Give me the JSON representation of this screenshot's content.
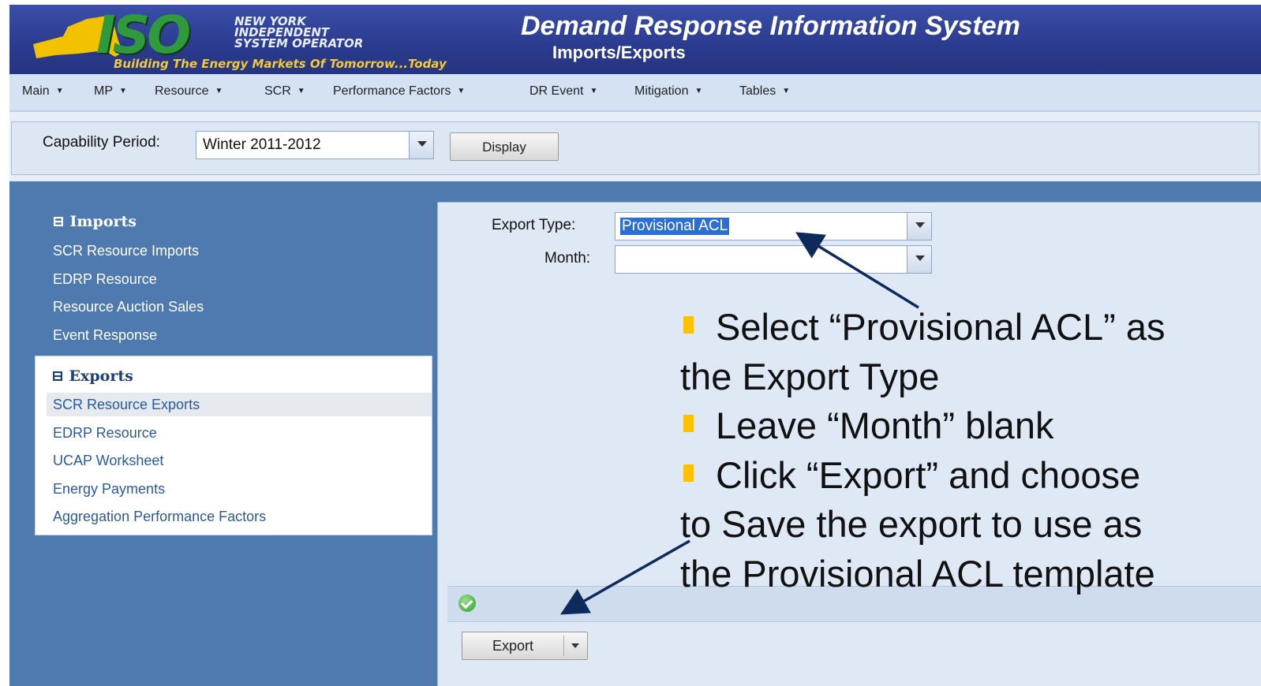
{
  "header": {
    "logo_lines": [
      "NEW YORK",
      "INDEPENDENT",
      "SYSTEM OPERATOR"
    ],
    "logo_mark": "ISO",
    "tagline": "Building The Energy Markets Of Tomorrow...Today",
    "app_title": "Demand Response Information System",
    "page_subtitle": "Imports/Exports"
  },
  "menu": [
    {
      "label": "Main"
    },
    {
      "label": "MP"
    },
    {
      "label": "Resource"
    },
    {
      "label": "SCR"
    },
    {
      "label": "Performance Factors"
    },
    {
      "label": "DR Event"
    },
    {
      "label": "Mitigation"
    },
    {
      "label": "Tables"
    }
  ],
  "toolbar": {
    "capability_label": "Capability Period:",
    "capability_value": "Winter 2011-2012",
    "display_label": "Display"
  },
  "sidebar": {
    "imports_title": "Imports",
    "imports_items": [
      "SCR Resource Imports",
      "EDRP Resource",
      "Resource Auction Sales",
      "Event Response"
    ],
    "exports_title": "Exports",
    "exports_items": [
      "SCR Resource Exports",
      "EDRP Resource",
      "UCAP Worksheet",
      "Energy Payments",
      "Aggregation Performance Factors"
    ],
    "exports_active": "SCR Resource Exports"
  },
  "form": {
    "export_type_label": "Export Type:",
    "export_type_value": "Provisional ACL",
    "month_label": "Month:",
    "month_value": "",
    "export_button": "Export"
  },
  "annotation": {
    "line1": "Select “Provisional ACL” as",
    "line2": "the Export Type",
    "line3": "Leave “Month” blank",
    "line4": "Click “Export” and choose",
    "line5": "to Save the export to use as",
    "line6": "the Provisional ACL template",
    "bullet_color": "#ffc000",
    "arrow_color": "#0e2a5c"
  }
}
